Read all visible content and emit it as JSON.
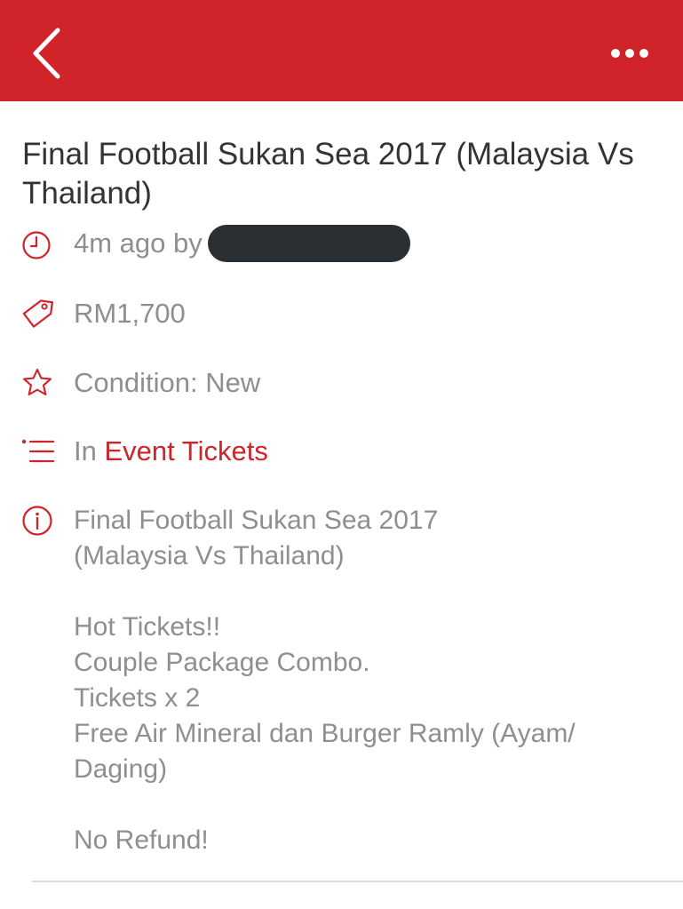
{
  "colors": {
    "brand": "#d0232a",
    "title_text": "#333333",
    "meta_text": "#8e8e93",
    "redaction": "#2a2f33"
  },
  "navbar": {
    "back_icon": "chevron-left-icon",
    "more_icon": "more-horizontal-icon"
  },
  "listing": {
    "title": "Final Football Sukan Sea 2017 (Malaysia Vs Thailand)",
    "posted": {
      "icon": "clock-icon",
      "time_by": "4m ago by"
    },
    "price": {
      "icon": "price-tag-icon",
      "value": "RM1,700"
    },
    "condition": {
      "icon": "star-icon",
      "value": "Condition: New"
    },
    "category": {
      "icon": "list-icon",
      "prefix": "In",
      "name": "Event Tickets"
    },
    "description": {
      "icon": "info-icon",
      "text": "Final Football Sukan Sea 2017\n(Malaysia Vs Thailand)\n\nHot Tickets!!\nCouple Package Combo.\nTickets x 2\nFree Air Mineral dan Burger Ramly (Ayam/\nDaging)\n\nNo Refund!"
    }
  }
}
